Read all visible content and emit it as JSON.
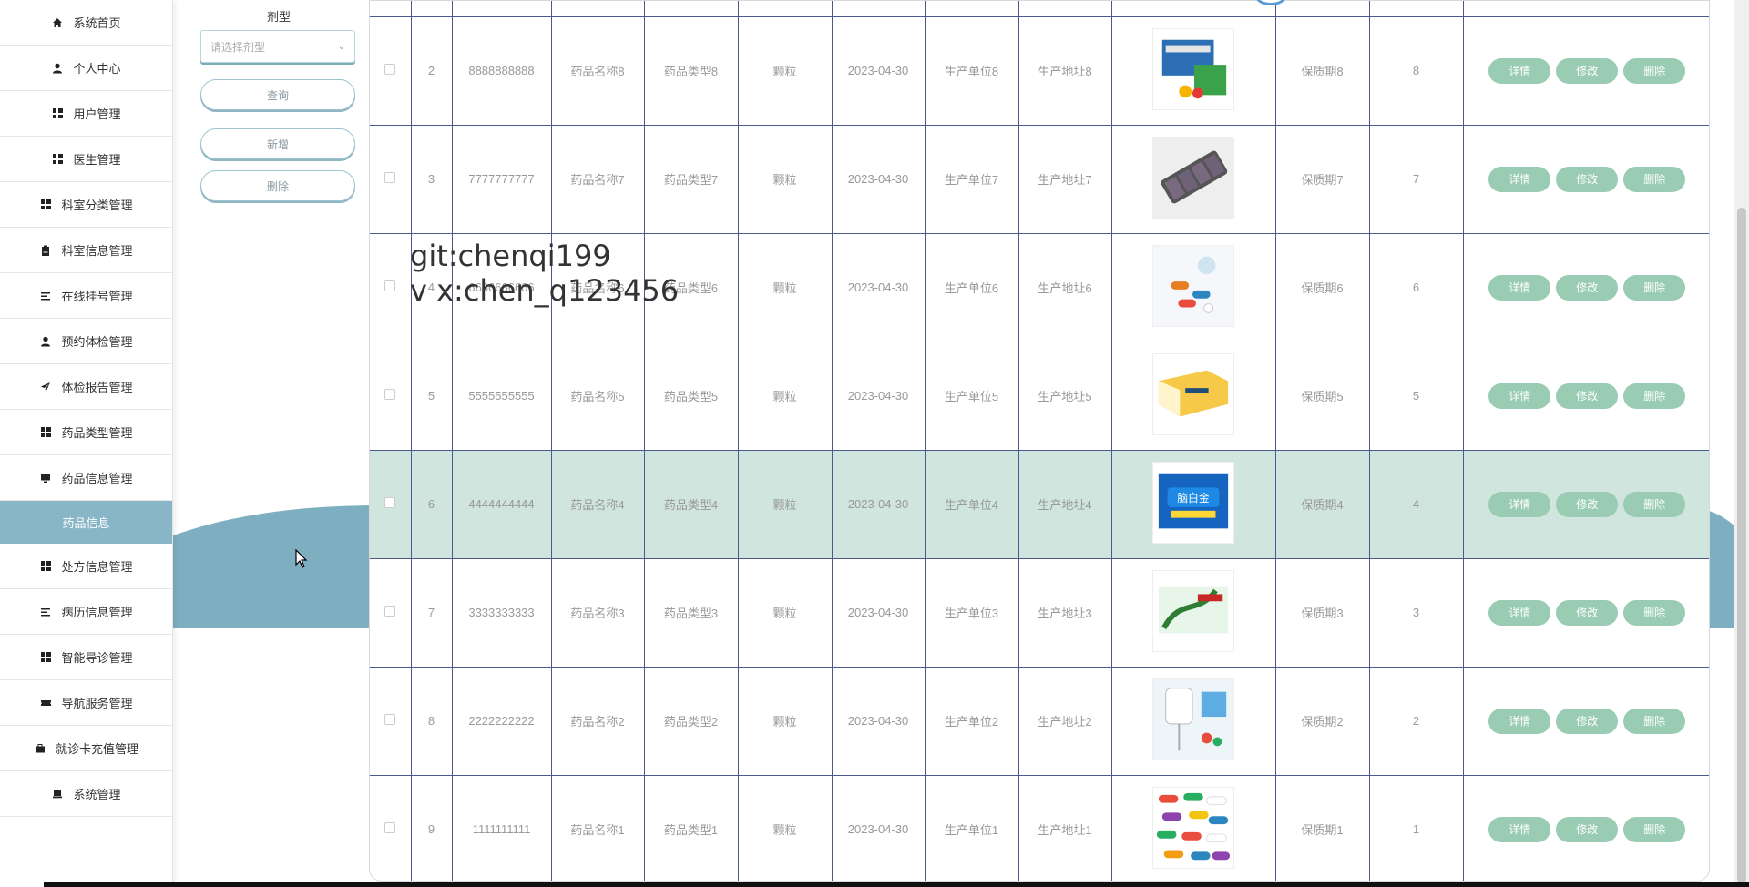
{
  "sidebar": {
    "items": [
      {
        "label": "系统首页",
        "icon": "home-icon"
      },
      {
        "label": "个人中心",
        "icon": "user-icon"
      },
      {
        "label": "用户管理",
        "icon": "grid-icon"
      },
      {
        "label": "医生管理",
        "icon": "grid-icon"
      },
      {
        "label": "科室分类管理",
        "icon": "grid-icon"
      },
      {
        "label": "科室信息管理",
        "icon": "clipboard-icon"
      },
      {
        "label": "在线挂号管理",
        "icon": "list-icon"
      },
      {
        "label": "预约体检管理",
        "icon": "user-icon"
      },
      {
        "label": "体检报告管理",
        "icon": "send-icon"
      },
      {
        "label": "药品类型管理",
        "icon": "grid-icon"
      },
      {
        "label": "药品信息管理",
        "icon": "monitor-icon"
      },
      {
        "label": "药品信息",
        "icon": "",
        "sub": true
      },
      {
        "label": "处方信息管理",
        "icon": "grid-icon"
      },
      {
        "label": "病历信息管理",
        "icon": "list-icon"
      },
      {
        "label": "智能导诊管理",
        "icon": "grid-icon"
      },
      {
        "label": "导航服务管理",
        "icon": "ticket-icon"
      },
      {
        "label": "就诊卡充值管理",
        "icon": "briefcase-icon"
      },
      {
        "label": "系统管理",
        "icon": "laptop-icon"
      }
    ]
  },
  "filter": {
    "label": "剂型",
    "select_placeholder": "请选择剂型",
    "query_label": "查询",
    "add_label": "新增",
    "delete_label": "删除"
  },
  "table": {
    "rows": [
      {
        "index": "2",
        "code": "8888888888",
        "name": "药品名称8",
        "type": "药品类型8",
        "form": "颗粒",
        "date": "2023-04-30",
        "maker": "生产单位8",
        "address": "生产地址8",
        "image": "medicine-box-photo",
        "shelf": "保质期8",
        "stock": "8"
      },
      {
        "index": "3",
        "code": "7777777777",
        "name": "药品名称7",
        "type": "药品类型7",
        "form": "颗粒",
        "date": "2023-04-30",
        "maker": "生产单位7",
        "address": "生产地址7",
        "image": "pill-organizer-photo",
        "shelf": "保质期7",
        "stock": "7"
      },
      {
        "index": "4",
        "code": "6666666666",
        "name": "药品名称6",
        "type": "药品类型6",
        "form": "颗粒",
        "date": "2023-04-30",
        "maker": "生产单位6",
        "address": "生产地址6",
        "image": "capsules-photo",
        "shelf": "保质期6",
        "stock": "6"
      },
      {
        "index": "5",
        "code": "5555555555",
        "name": "药品名称5",
        "type": "药品类型5",
        "form": "颗粒",
        "date": "2023-04-30",
        "maker": "生产单位5",
        "address": "生产地址5",
        "image": "yellow-box-photo",
        "shelf": "保质期5",
        "stock": "5"
      },
      {
        "index": "6",
        "code": "4444444444",
        "name": "药品名称4",
        "type": "药品类型4",
        "form": "颗粒",
        "date": "2023-04-30",
        "maker": "生产单位4",
        "address": "生产地址4",
        "image": "blue-box-photo",
        "shelf": "保质期4",
        "stock": "4",
        "highlight": true
      },
      {
        "index": "7",
        "code": "3333333333",
        "name": "药品名称3",
        "type": "药品类型3",
        "form": "颗粒",
        "date": "2023-04-30",
        "maker": "生产单位3",
        "address": "生产地址3",
        "image": "green-box-photo",
        "shelf": "保质期3",
        "stock": "3"
      },
      {
        "index": "8",
        "code": "2222222222",
        "name": "药品名称2",
        "type": "药品类型2",
        "form": "颗粒",
        "date": "2023-04-30",
        "maker": "生产单位2",
        "address": "生产地址2",
        "image": "iv-drip-photo",
        "shelf": "保质期2",
        "stock": "2"
      },
      {
        "index": "9",
        "code": "1111111111",
        "name": "药品名称1",
        "type": "药品类型1",
        "form": "颗粒",
        "date": "2023-04-30",
        "maker": "生产单位1",
        "address": "生产地址1",
        "image": "colorful-pills-photo",
        "shelf": "保质期1",
        "stock": "1"
      }
    ],
    "ops": {
      "detail": "详情",
      "edit": "修改",
      "delete": "删除"
    }
  },
  "watermark": {
    "line1": "git:chenqi199",
    "line2": "v x:chen_q123456"
  },
  "colors": {
    "accent": "#88b6c7",
    "op_button": "#99ccb3",
    "highlight_row": "#cfe5dd",
    "grid_line": "#4a5a8a"
  }
}
